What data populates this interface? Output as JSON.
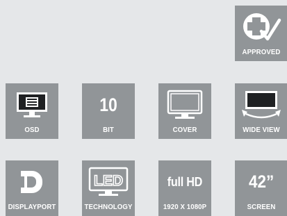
{
  "badges": {
    "approved": {
      "caption": "APPROVED",
      "icon": "approved-cross-check-icon"
    },
    "osd": {
      "caption": "OSD",
      "icon": "osd-monitor-icon"
    },
    "bit": {
      "value": "10",
      "caption": "BIT"
    },
    "cover": {
      "caption": "COVER",
      "icon": "monitor-cover-icon"
    },
    "wide_view": {
      "caption": "WIDE VIEW",
      "icon": "wide-view-icon"
    },
    "displayport": {
      "caption": "DISPLAYPORT",
      "icon": "displayport-logo-icon"
    },
    "led": {
      "caption": "TECHNOLOGY",
      "icon": "led-monitor-icon",
      "logo_text": "LED"
    },
    "fullhd": {
      "value": "full HD",
      "caption": "1920 X 1080P"
    },
    "screen": {
      "value": "42”",
      "caption": "SCREEN"
    }
  },
  "colors": {
    "tile": "#919598",
    "background": "#e5e7e9",
    "foreground": "#ffffff",
    "screen_dark": "#1f2123"
  }
}
